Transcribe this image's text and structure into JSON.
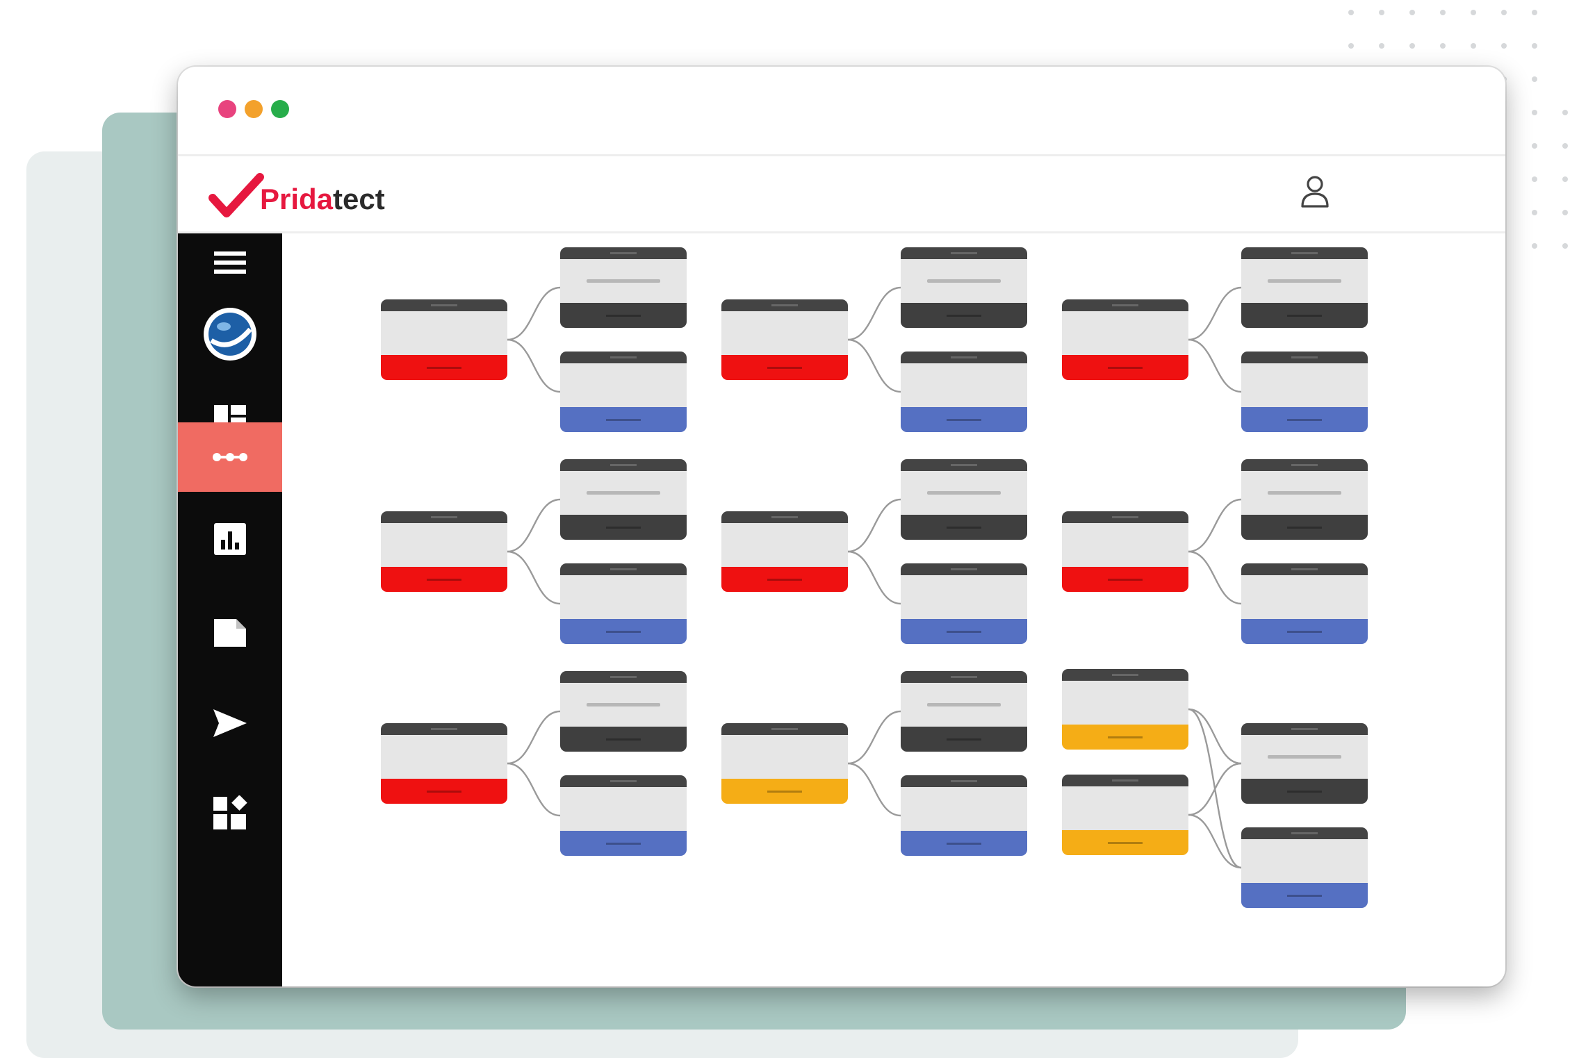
{
  "app": {
    "brand_part1": "Prida",
    "brand_part2": "tect",
    "brand_color": "#e6183f",
    "window_controls": [
      {
        "name": "close",
        "color": "#e8437e"
      },
      {
        "name": "minimize",
        "color": "#f3a12c"
      },
      {
        "name": "maximize",
        "color": "#27ad4a"
      }
    ]
  },
  "header": {
    "user_icon": "user-icon"
  },
  "sidebar": {
    "items": [
      {
        "name": "menu",
        "icon": "hamburger-icon",
        "active": false
      },
      {
        "name": "planet",
        "icon": "planet-logo-icon",
        "active": false
      },
      {
        "name": "dashboard",
        "icon": "dashboard-icon",
        "active": false
      },
      {
        "name": "workflow",
        "icon": "more-dots-icon",
        "active": true
      },
      {
        "name": "reports",
        "icon": "bar-chart-icon",
        "active": false
      },
      {
        "name": "documents",
        "icon": "document-icon",
        "active": false
      },
      {
        "name": "send",
        "icon": "send-icon",
        "active": false
      },
      {
        "name": "widgets",
        "icon": "widgets-icon",
        "active": false
      }
    ],
    "active_color": "#f06b62"
  },
  "status_colors": {
    "red": "#ef1111",
    "blue": "#5570c2",
    "dark": "#3f3f3f",
    "yellow": "#f5ad16"
  },
  "flows": [
    {
      "row": 1,
      "col": 1,
      "source": "red",
      "targets": [
        "dark",
        "blue"
      ]
    },
    {
      "row": 1,
      "col": 2,
      "source": "red",
      "targets": [
        "dark",
        "blue"
      ]
    },
    {
      "row": 1,
      "col": 3,
      "source": "red",
      "targets": [
        "dark",
        "blue"
      ]
    },
    {
      "row": 2,
      "col": 1,
      "source": "red",
      "targets": [
        "dark",
        "blue"
      ]
    },
    {
      "row": 2,
      "col": 2,
      "source": "red",
      "targets": [
        "dark",
        "blue"
      ]
    },
    {
      "row": 2,
      "col": 3,
      "source": "red",
      "targets": [
        "dark",
        "blue"
      ]
    },
    {
      "row": 3,
      "col": 1,
      "source": "red",
      "targets": [
        "dark",
        "blue"
      ]
    },
    {
      "row": 3,
      "col": 2,
      "source": "yellow",
      "targets": [
        "dark",
        "blue"
      ]
    },
    {
      "row": 3,
      "col": 3,
      "sources": [
        "yellow",
        "yellow"
      ],
      "targets": [
        "dark",
        "blue"
      ]
    }
  ]
}
